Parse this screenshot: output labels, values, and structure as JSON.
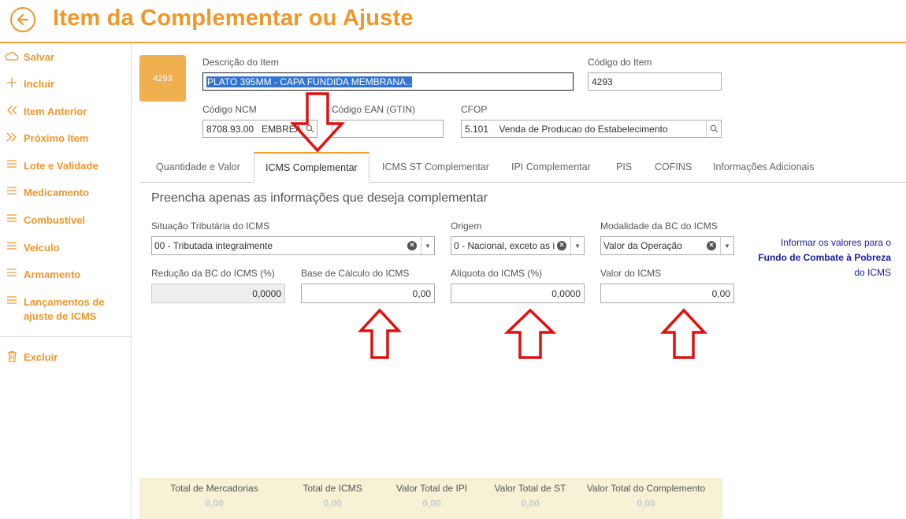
{
  "header": {
    "title": "Item da Complementar ou Ajuste",
    "back_icon": "arrow-left-icon"
  },
  "sidebar": {
    "items": [
      {
        "label": "Salvar",
        "icon": "cloud-icon"
      },
      {
        "label": "Incluir",
        "icon": "plus-icon"
      },
      {
        "label": "Item Anterior",
        "icon": "double-chevron-left-icon"
      },
      {
        "label": "Próximo Item",
        "icon": "double-chevron-right-icon"
      },
      {
        "label": "Lote e Validade",
        "icon": "menu-icon"
      },
      {
        "label": "Medicamento",
        "icon": "menu-icon"
      },
      {
        "label": "Combustível",
        "icon": "menu-icon"
      },
      {
        "label": "Veículo",
        "icon": "menu-icon"
      },
      {
        "label": "Armamento",
        "icon": "menu-icon"
      },
      {
        "label": "Lançamentos de ajuste de ICMS",
        "icon": "menu-icon"
      },
      {
        "label": "Excluir",
        "icon": "trash-icon"
      }
    ]
  },
  "item": {
    "thumb_text": "4293",
    "descricao_label": "Descrição do Item",
    "descricao_value": "PLATO 395MM - CAPA FUNDIDA MEMBRANA..",
    "codigo_label": "Código do Item",
    "codigo_value": "4293",
    "ncm_label": "Código NCM",
    "ncm_value": "8708.93.00   EMBREA",
    "ean_label": "Código EAN (GTIN)",
    "ean_value": "",
    "cfop_label": "CFOP",
    "cfop_value": "5.101    Venda de Producao do Estabelecimento"
  },
  "tabs": [
    {
      "label": "Quantidade e Valor",
      "active": false
    },
    {
      "label": "ICMS Complementar",
      "active": true
    },
    {
      "label": "ICMS ST Complementar",
      "active": false
    },
    {
      "label": "IPI Complementar",
      "active": false
    },
    {
      "label": "PIS",
      "active": false
    },
    {
      "label": "COFINS",
      "active": false
    },
    {
      "label": "Informações Adicionais",
      "active": false
    }
  ],
  "icms": {
    "subtitle": "Preencha apenas as informações que deseja complementar",
    "situacao_label": "Situação Tributária do ICMS",
    "situacao_value": "00 - Tributada integralmente",
    "origem_label": "Origem",
    "origem_value": "0 - Nacional, exceto as i",
    "modalidade_label": "Modalidade da BC do ICMS",
    "modalidade_value": "Valor da Operação",
    "reducao_label": "Redução da BC do ICMS (%)",
    "reducao_value": "0,0000",
    "base_label": "Base de Cálculo do ICMS",
    "base_value": "0,00",
    "aliquota_label": "Alíquota do ICMS (%)",
    "aliquota_value": "0,0000",
    "valor_label": "Valor do ICMS",
    "valor_value": "0,00",
    "fcp_line1": "Informar os valores para o",
    "fcp_line2": "Fundo de Combate à Pobreza",
    "fcp_line3": "do ICMS"
  },
  "totals": [
    {
      "label": "Total de Mercadorias",
      "value": "0,00"
    },
    {
      "label": "Total de ICMS",
      "value": "0,00"
    },
    {
      "label": "Valor Total de IPI",
      "value": "0,00"
    },
    {
      "label": "Valor Total de ST",
      "value": "0,00"
    },
    {
      "label": "Valor Total do Complemento",
      "value": "0,00"
    }
  ],
  "colors": {
    "accent": "#f0962a",
    "arrow": "#e01010",
    "link": "#1a1aaa"
  }
}
